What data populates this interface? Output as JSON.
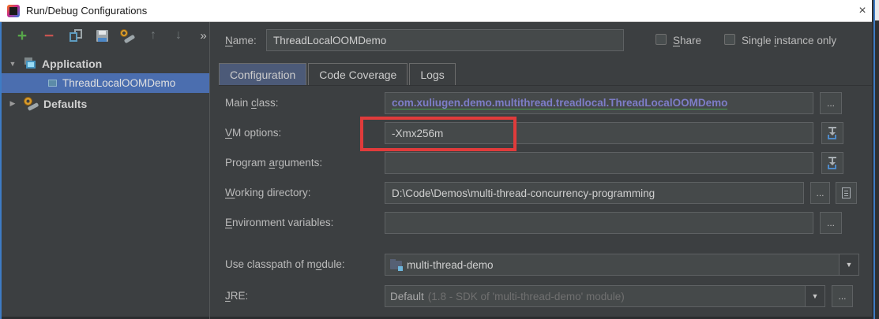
{
  "window": {
    "title": "Run/Debug Configurations",
    "close_glyph": "×"
  },
  "toolbar": {
    "add_glyph": "+",
    "remove_glyph": "−",
    "up_glyph": "↑",
    "down_glyph": "↓",
    "more_glyph": "»"
  },
  "tree": {
    "expand_open": "▼",
    "expand_closed": "▶",
    "application_label": "Application",
    "selected_label": "ThreadLocalOOMDemo",
    "defaults_label": "Defaults"
  },
  "header": {
    "name_label": {
      "pre": "",
      "key": "N",
      "post": "ame:"
    },
    "name_value": "ThreadLocalOOMDemo",
    "share_label": {
      "pre": "",
      "key": "S",
      "post": "hare"
    },
    "single_label": {
      "pre": "Single ",
      "key": "i",
      "post": "nstance only"
    }
  },
  "tabs": {
    "configuration": "Configuration",
    "code_coverage": "Code Coverage",
    "logs": "Logs"
  },
  "form": {
    "main_class": {
      "label": {
        "pre": "Main ",
        "key": "c",
        "post": "lass:"
      },
      "value": "com.xuliugen.demo.multithread.treadlocal.ThreadLocalOOMDemo"
    },
    "vm_options": {
      "label": {
        "pre": "",
        "key": "V",
        "post": "M options:"
      },
      "value": "-Xmx256m"
    },
    "program_arguments": {
      "label": {
        "pre": "Program ",
        "key": "a",
        "post": "rguments:"
      },
      "value": ""
    },
    "working_directory": {
      "label": {
        "pre": "",
        "key": "W",
        "post": "orking directory:"
      },
      "value": "D:\\Code\\Demos\\multi-thread-concurrency-programming"
    },
    "environment_variables": {
      "label": {
        "pre": "",
        "key": "E",
        "post": "nvironment variables:"
      },
      "value": ""
    },
    "module": {
      "label": {
        "pre": "Use classpath of m",
        "key": "o",
        "post": "dule:"
      },
      "value": "multi-thread-demo"
    },
    "jre": {
      "label": {
        "pre": "",
        "key": "J",
        "post": "RE:"
      },
      "value_main": "Default",
      "value_detail": "(1.8 - SDK of 'multi-thread-demo' module)"
    }
  },
  "glyphs": {
    "ellipsis": "...",
    "dropdown_arrow": "▼"
  },
  "colors": {
    "selection": "#4B6EAF",
    "annotation_red": "#E03B3B",
    "main_class_text": "#7D7DC7",
    "tab_selected": "#4C5A78",
    "window_border_blue": "#3E7CC5"
  }
}
